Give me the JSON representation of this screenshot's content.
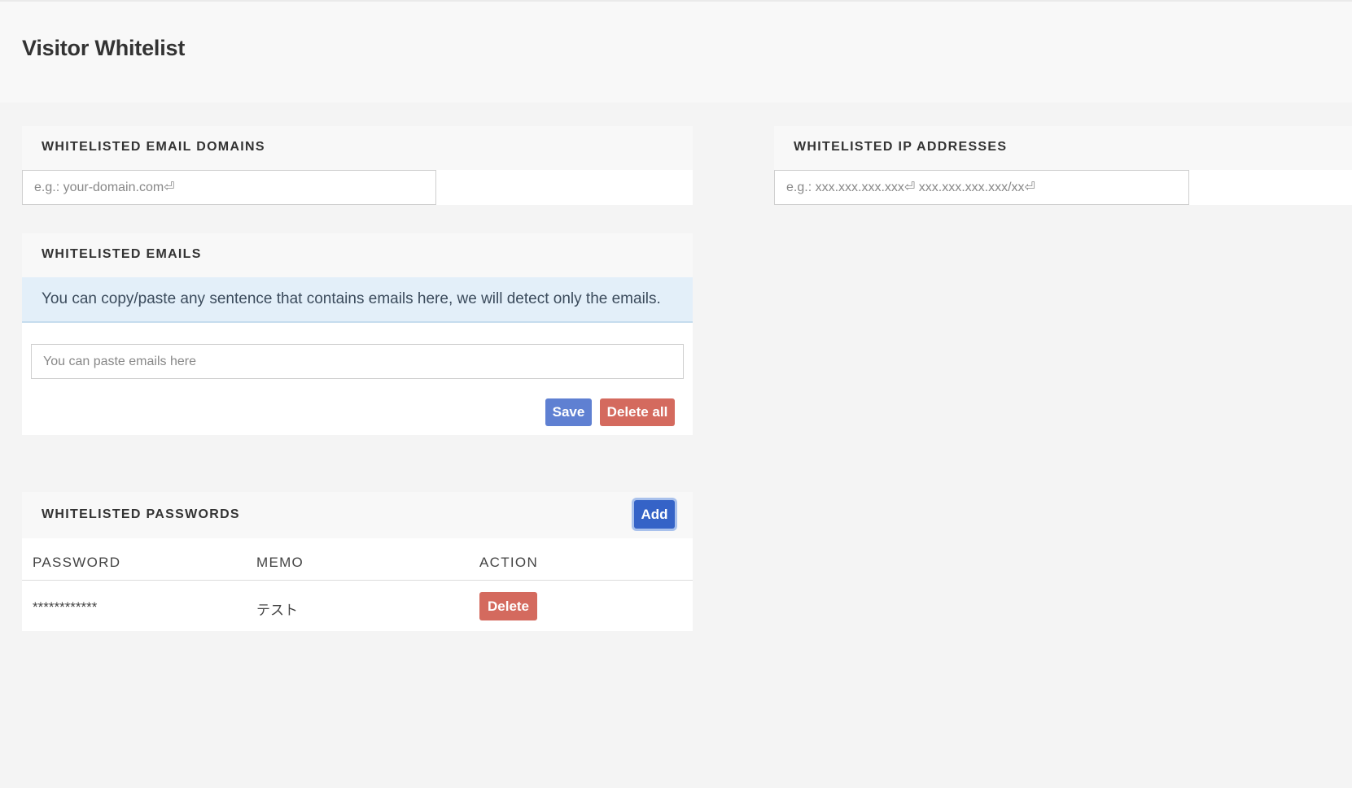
{
  "page": {
    "title": "Visitor Whitelist"
  },
  "email_domains": {
    "title": "WHITELISTED EMAIL DOMAINS",
    "placeholder": "e.g.: your-domain.com⏎"
  },
  "ip_addresses": {
    "title": "WHITELISTED IP ADDRESSES",
    "placeholder": "e.g.: xxx.xxx.xxx.xxx⏎ xxx.xxx.xxx.xxx/xx⏎"
  },
  "emails": {
    "title": "WHITELISTED EMAILS",
    "info": "You can copy/paste any sentence that contains emails here, we will detect only the emails.",
    "placeholder": "You can paste emails here",
    "save_label": "Save",
    "delete_all_label": "Delete all"
  },
  "passwords": {
    "title": "WHITELISTED PASSWORDS",
    "add_label": "Add",
    "columns": [
      "PASSWORD",
      "MEMO",
      "ACTION"
    ],
    "rows": [
      {
        "password": "************",
        "memo": "テスト",
        "action_label": "Delete"
      }
    ]
  },
  "colors": {
    "primary": "#5f80d2",
    "primary_active": "#3563c7",
    "danger": "#d46a5e",
    "info_bg": "#e3eff9"
  }
}
